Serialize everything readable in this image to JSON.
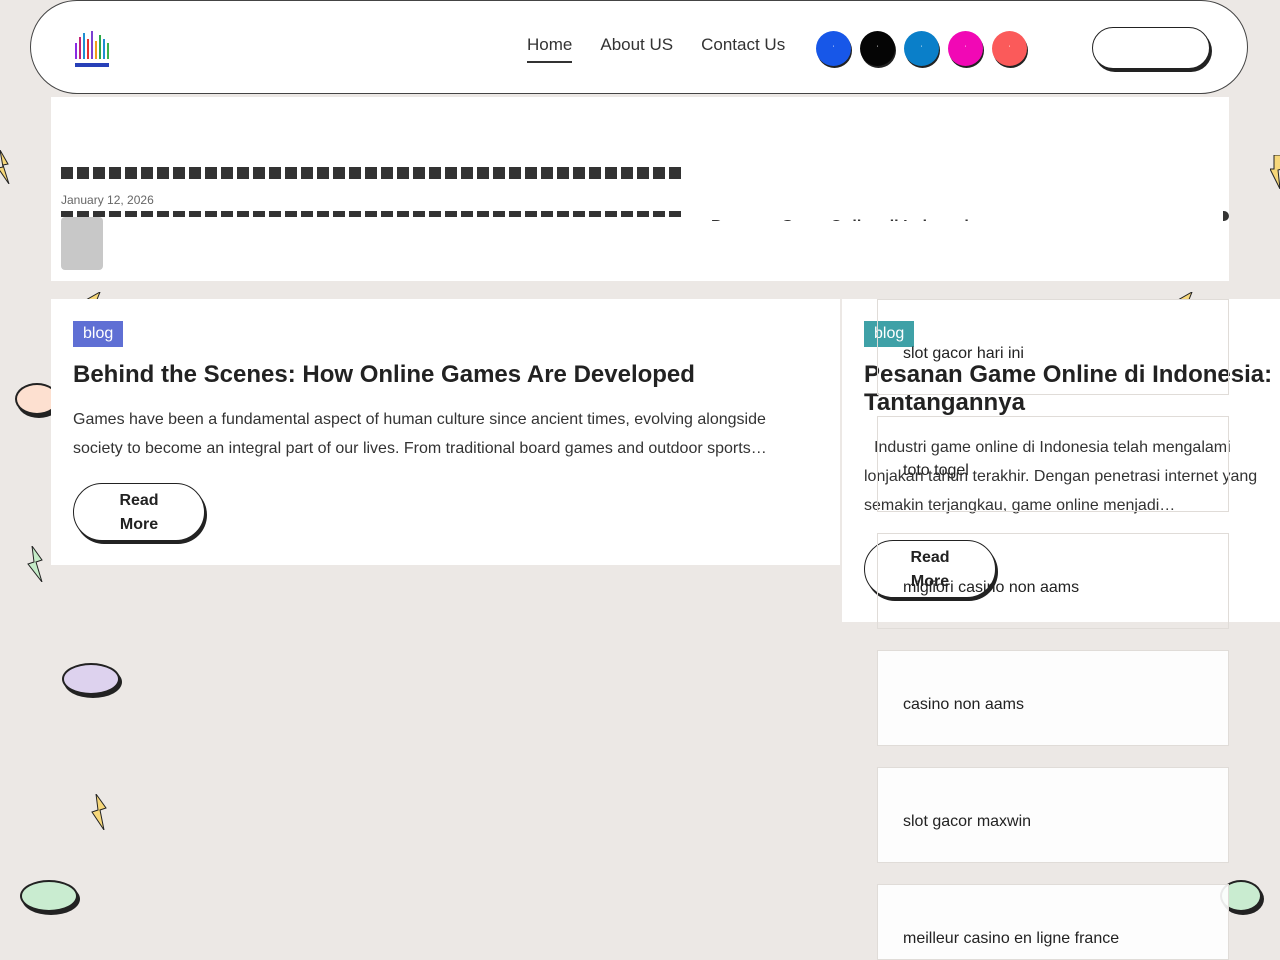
{
  "header": {
    "logo_alt": "logo",
    "nav": [
      {
        "label": "Home",
        "active": true
      },
      {
        "label": "About US",
        "active": false
      },
      {
        "label": "Contact Us",
        "active": false
      }
    ],
    "socials": [
      {
        "name": "facebook-icon",
        "color": "#1757e8",
        "glyph": "f"
      },
      {
        "name": "x-icon",
        "color": "#050505",
        "glyph": "x"
      },
      {
        "name": "linkedin-icon",
        "color": "#0a7fc9",
        "glyph": "in"
      },
      {
        "name": "instagram-icon",
        "color": "#f108b5",
        "glyph": "ig"
      },
      {
        "name": "youtube-icon",
        "color": "#fb5a5a",
        "glyph": "yt"
      }
    ],
    "button_label": ""
  },
  "ticker": {
    "date": "January 12, 2026",
    "next_title": "Pesanan Game Online di Indonesia: Peluang dan Tantangannya"
  },
  "posts": [
    {
      "category": "blog",
      "title": "Behind the Scenes: How Online Games Are Developed",
      "excerpt": "Games have been a fundamental aspect of human culture since ancient times, evolving alongside society to become an integral part of our lives. From traditional board games and outdoor sports…",
      "read_more": "Read More"
    },
    {
      "category": "blog",
      "title": "Pesanan Game Online di Indonesia: Tantangannya",
      "excerpt": "Industri game online di Indonesia telah mengalami lonjakan tahun terakhir. Dengan penetrasi internet yang semakin terjangkau, game online menjadi…",
      "read_more": "Read More"
    }
  ],
  "sidebar_links": [
    "slot gacor hari ini",
    "toto togel",
    "migliori casino non aams",
    "casino non aams",
    "slot gacor maxwin",
    "meilleur casino en ligne france"
  ],
  "colors": {
    "background": "#ece8e5",
    "tag_blue": "#5f6fd4",
    "tag_teal": "#3fa1a7"
  }
}
